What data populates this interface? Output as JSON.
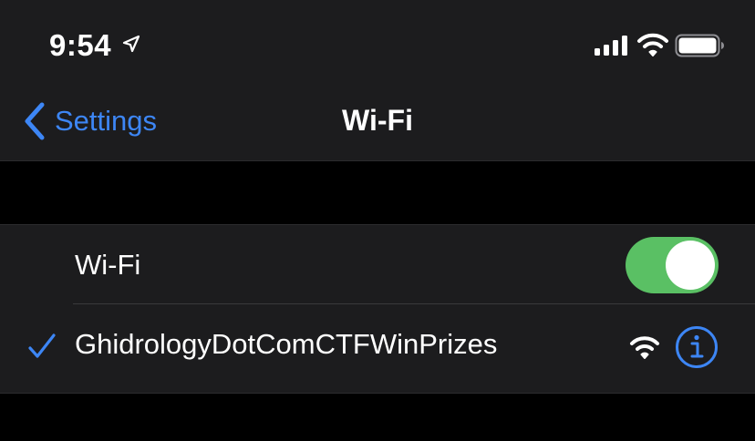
{
  "status_bar": {
    "time": "9:54",
    "icons": [
      "location-arrow-icon",
      "cellular-signal-icon",
      "wifi-icon",
      "battery-icon"
    ]
  },
  "nav": {
    "back_label": "Settings",
    "title": "Wi-Fi"
  },
  "wifi_toggle": {
    "label": "Wi-Fi",
    "on": true
  },
  "network": {
    "name": "GhidrologyDotComCTFWinPrizes",
    "connected": true
  },
  "colors": {
    "accent": "#3d86f5",
    "toggle_on": "#5ac064",
    "background": "#000000",
    "cell": "#1c1c1e"
  }
}
